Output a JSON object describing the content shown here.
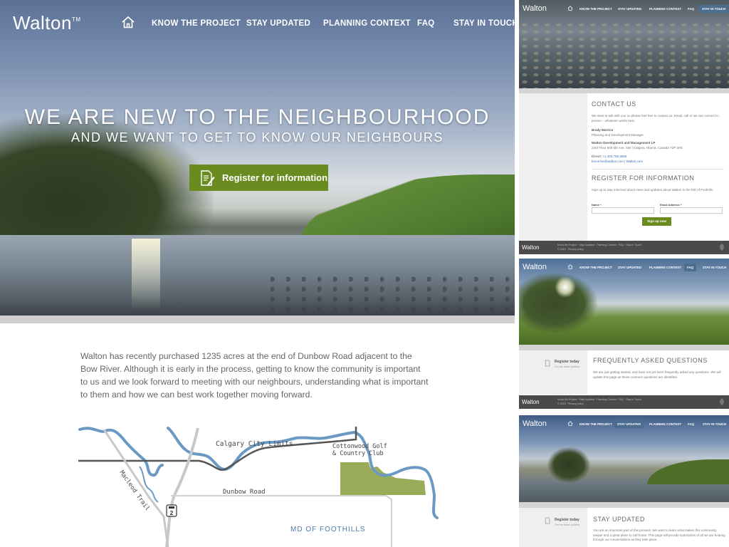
{
  "main": {
    "logo": "Walton",
    "logo_tm": "TM",
    "nav": [
      "KNOW THE PROJECT",
      "STAY UPDATED",
      "PLANNING CONTEXT",
      "FAQ",
      "STAY IN TOUCH"
    ],
    "hero_title": "WE ARE NEW TO THE NEIGHBOURHOOD",
    "hero_subtitle": "AND WE WANT TO GET TO KNOW OUR NEIGHBOURS",
    "register_button": "Register for information",
    "intro": "Walton has recently purchased 1235 acres at the end of Dunbow Road adjacent to the Bow River. Although it is early in the process, getting to know the community is important to us and we look forward to meeting with our neighbours, understanding what is important to them and how we can best work together moving forward.",
    "map": {
      "calgary_limits": "Calgary City Limits",
      "golf_line1": "Cottonwood Golf",
      "golf_line2": "& Country Club",
      "macleod": "Macleod Trail",
      "dunbow": "Dunbow Road",
      "highway": "2",
      "md": "MD OF FOOTHILLS"
    },
    "colors": {
      "accent_green": "#6a8b1f",
      "river_blue": "#6a9ac4",
      "parcel_green": "#9aab5a",
      "nav_active": "#4b6d8f",
      "footer": "#4a4a4a"
    }
  },
  "thumbs": {
    "logo": "Walton",
    "nav": [
      "KNOW THE PROJECT",
      "STAY UPDATED",
      "PLANNING CONTEXT",
      "FAQ",
      "STAY IN TOUCH"
    ],
    "contact": {
      "title": "CONTACT US",
      "intro": "We want to talk with you so please feel free to contact us. Email, call or we can connect in person – whatever works best.",
      "name": "Brady Morrice",
      "role": "Planning and Development Manager",
      "company": "Walton Development and Management LP",
      "address": "23rd Floor 605 5th Ave. SW | Calgary, Alberta, Canada T2P 3H5",
      "direct_label": "Direct:",
      "direct": "+1 403.750.3568",
      "email": "bmorrice@walton.com | Walton.com"
    },
    "register": {
      "title": "REGISTER FOR INFORMATION",
      "intro": "Sign up to stay informed about news and updates about Walton in the MD of Foothills.",
      "name_label": "Name *",
      "email_label": "Email Address *",
      "button": "Sign up now"
    },
    "footer": {
      "logo": "Walton",
      "links": "Know the Project · Stay Updated · Planning Context · FAQ · Stay in Touch",
      "copyright": "© 2015 · Privacy policy"
    },
    "faq": {
      "register_today": "Register today",
      "register_sub": "Get the latest updates",
      "title": "FREQUENTLY ASKED QUESTIONS",
      "text": "We are just getting started, and have not yet been frequently asked any questions. We will update this page as these common questions are identified."
    },
    "stay": {
      "register_today": "Register today",
      "register_sub": "Get the latest updates",
      "title": "STAY UPDATED",
      "text": "You are an important part of this process. We want to learn what makes this community unique and a great place to call home. This page will provide summaries of all we are hearing through our conversations as they take place."
    }
  }
}
